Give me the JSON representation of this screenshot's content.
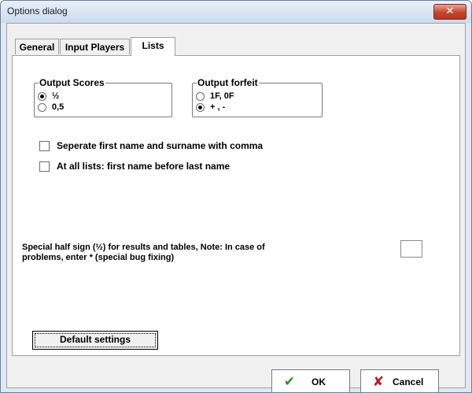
{
  "window": {
    "title": "Options dialog",
    "close_glyph": "✕"
  },
  "tabs": [
    {
      "label": "General",
      "active": false
    },
    {
      "label": "Input Players",
      "active": false
    },
    {
      "label": "Lists",
      "active": true
    }
  ],
  "lists_tab": {
    "output_scores": {
      "legend": "Output Scores",
      "options": [
        {
          "label": "½",
          "selected": true
        },
        {
          "label": "0,5",
          "selected": false
        }
      ]
    },
    "output_forfeit": {
      "legend": "Output forfeit",
      "options": [
        {
          "label": "1F, 0F",
          "selected": false
        },
        {
          "label": "+ , -",
          "selected": true
        }
      ]
    },
    "checkboxes": [
      {
        "label": "Seperate first name and surname with comma",
        "checked": false
      },
      {
        "label": "At all lists: first name before last name",
        "checked": false
      }
    ],
    "half_sign_note": "Special half sign (½) for results and tables, Note: In case of problems, enter * (special bug fixing)",
    "half_sign_value": "",
    "default_button": "Default settings"
  },
  "buttons": {
    "ok": {
      "label": "OK",
      "icon": "checkmark-icon",
      "glyph": "✔",
      "color": "#2e8b2e"
    },
    "cancel": {
      "label": "Cancel",
      "icon": "cross-icon",
      "glyph": "✘",
      "color": "#b02020"
    }
  }
}
